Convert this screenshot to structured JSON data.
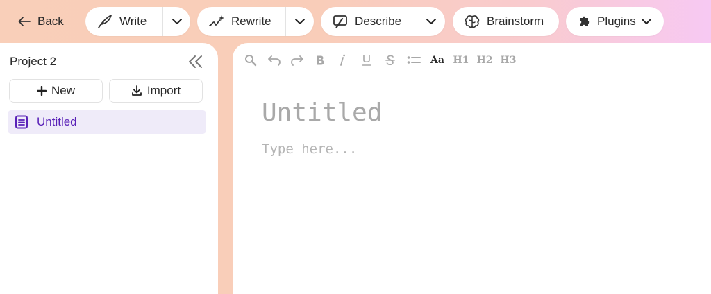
{
  "toolbar": {
    "back_label": "Back",
    "write_label": "Write",
    "rewrite_label": "Rewrite",
    "describe_label": "Describe",
    "brainstorm_label": "Brainstorm",
    "plugins_label": "Plugins"
  },
  "sidebar": {
    "project_title": "Project 2",
    "new_label": "New",
    "import_label": "Import",
    "documents": [
      {
        "label": "Untitled",
        "selected": true
      }
    ]
  },
  "editor": {
    "format_buttons": [
      "search",
      "undo",
      "redo",
      "bold",
      "italic",
      "underline",
      "strikethrough",
      "list",
      "Aa",
      "H1",
      "H2",
      "H3"
    ],
    "aa_label": "Aa",
    "h1_label": "H1",
    "h2_label": "H2",
    "h3_label": "H3",
    "title_placeholder": "Untitled",
    "body_placeholder": "Type here..."
  },
  "colors": {
    "accent": "#5a22b8",
    "selected_bg": "#efebf9",
    "placeholder": "#a9a9a9"
  }
}
